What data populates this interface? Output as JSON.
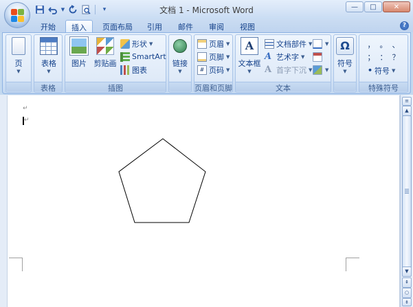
{
  "window": {
    "title": "文档 1 - Microsoft Word",
    "controls": {
      "minimize": "—",
      "maximize": "□",
      "close": "✕"
    }
  },
  "quick_access": {
    "save_icon": "save-icon",
    "undo_icon": "undo-icon",
    "redo_icon": "redo-icon",
    "print_preview_icon": "print-preview-icon",
    "customize_icon": "customize-qat-icon"
  },
  "tabs": [
    {
      "label": "开始"
    },
    {
      "label": "插入",
      "active": true
    },
    {
      "label": "页面布局"
    },
    {
      "label": "引用"
    },
    {
      "label": "邮件"
    },
    {
      "label": "审阅"
    },
    {
      "label": "视图"
    }
  ],
  "ribbon": {
    "pages": {
      "button": "页"
    },
    "tables": {
      "button": "表格",
      "group_label": "表格"
    },
    "illustrations": {
      "picture": "图片",
      "clipart": "剪贴画",
      "shapes": "形状",
      "smartart": "SmartArt",
      "chart": "图表",
      "group_label": "插图"
    },
    "links": {
      "button": "链接"
    },
    "header_footer": {
      "header": "页眉",
      "footer": "页脚",
      "page_number": "页码",
      "group_label": "页眉和页脚"
    },
    "text": {
      "textbox": "文本框",
      "quick_parts": "文档部件",
      "wordart": "艺术字",
      "dropcap": "首字下沉",
      "textbox_icon_letter": "A",
      "wordart_icon_letter": "A",
      "dropcap_icon_letter": "A",
      "group_label": "文本"
    },
    "symbols": {
      "button": "符号",
      "icon_glyph": "Ω"
    },
    "special_symbols": {
      "grid": [
        "，",
        "。",
        "、",
        "；",
        "：",
        "？"
      ],
      "symbol_dropdown": "符号",
      "group_label": "特殊符号"
    }
  },
  "document": {
    "paragraph_mark": "↵",
    "shape": "pentagon"
  },
  "scrollbar": {
    "up_arrow": "▲",
    "down_arrow": "▼",
    "prev_page": "⇞",
    "browse_object": "○",
    "next_page": "⇟",
    "ruler_toggle": "ruler-icon"
  },
  "colors": {
    "accent": "#15428b",
    "ribbon_bg": "#dfeaf8",
    "doc_bg": "#ffffff"
  }
}
